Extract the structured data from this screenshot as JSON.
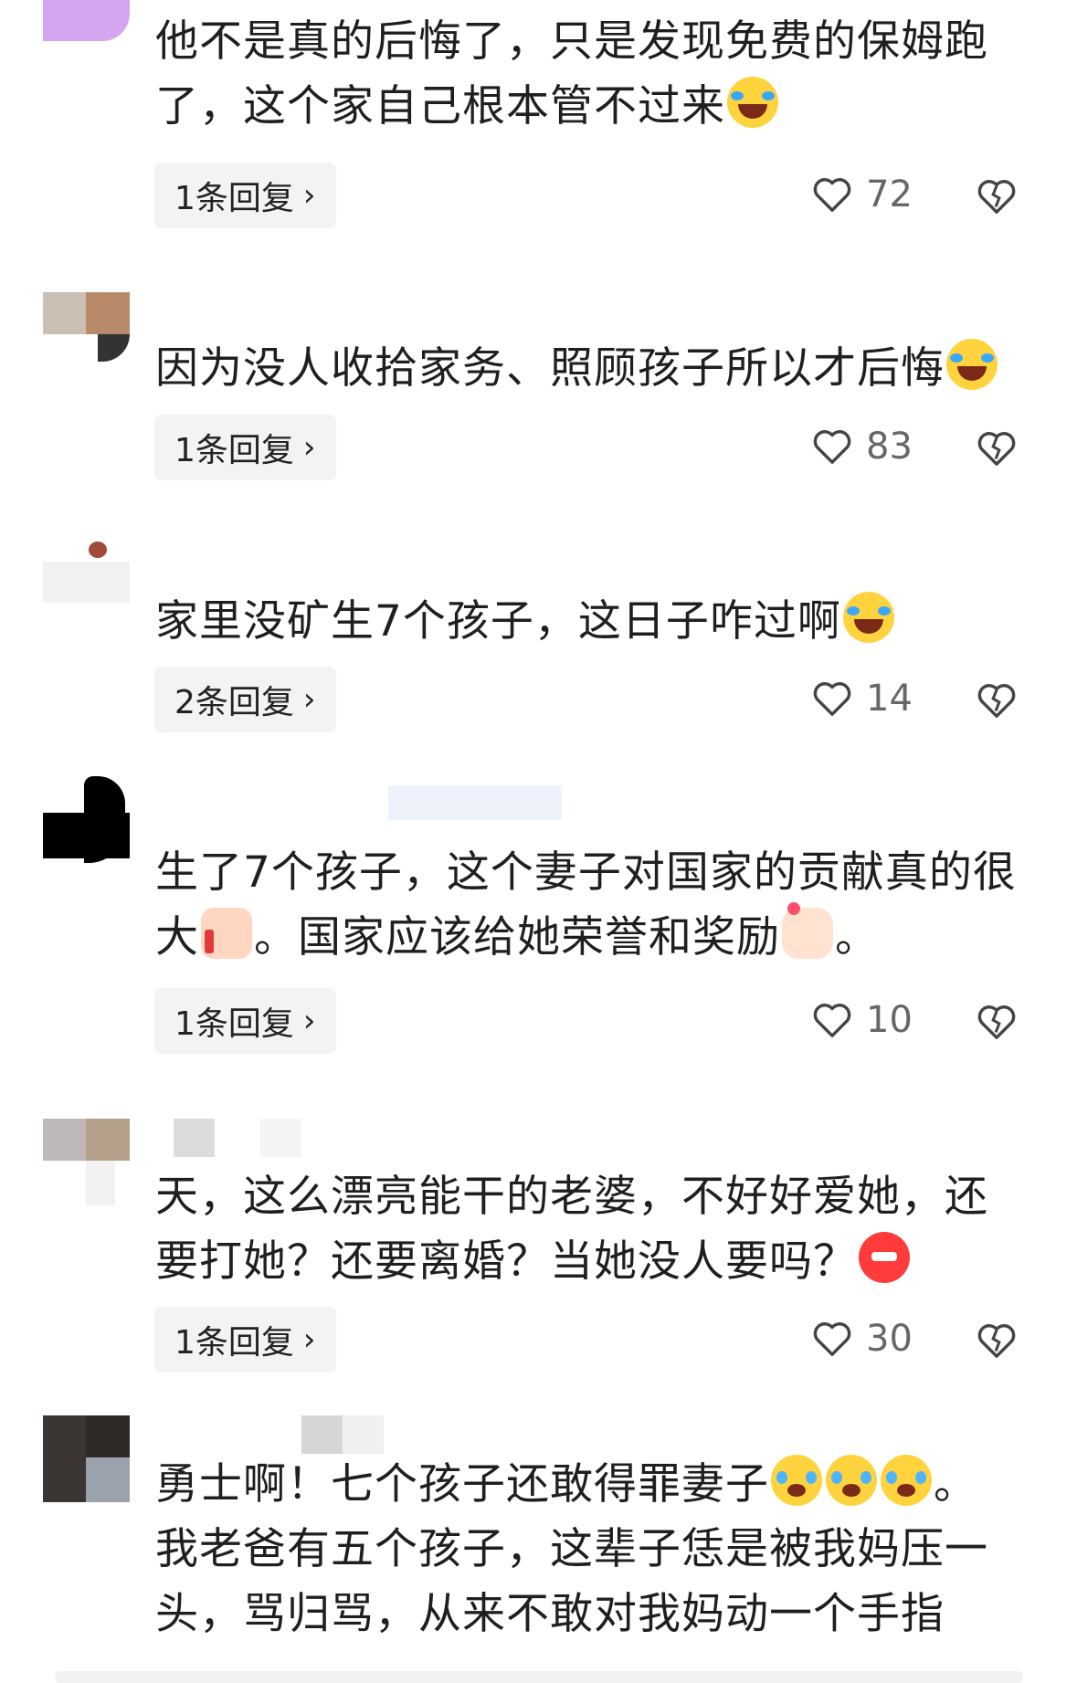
{
  "comments": [
    {
      "text_parts": [
        "他不是真的后悔了，只是发现免费的保姆跑",
        "了，这个家自己根本管不过来"
      ],
      "emoji": [
        "laugh-cry-icon"
      ],
      "reply_label": "1条回复",
      "likes": "72"
    },
    {
      "text_parts": [
        "因为没人收拾家务、照顾孩子所以才后悔"
      ],
      "emoji": [
        "laughing-icon"
      ],
      "reply_label": "1条回复",
      "likes": "83"
    },
    {
      "text_parts": [
        "家里没矿生7个孩子，这日子咋过啊"
      ],
      "emoji": [
        "laugh-cry-icon"
      ],
      "reply_label": "2条回复",
      "likes": "14"
    },
    {
      "text_parts": [
        "生了7个孩子，这个妻子对国家的贡献真的很",
        "大",
        "。国家应该给她荣誉和奖励",
        "。"
      ],
      "emoji": [
        "thumbs-up-icon",
        "finger-heart-icon"
      ],
      "reply_label": "1条回复",
      "likes": "10"
    },
    {
      "text_parts": [
        "天，这么漂亮能干的老婆，不好好爱她，还",
        "要打她？还要离婚？当她没人要吗？"
      ],
      "emoji": [
        "angry-face-icon"
      ],
      "reply_label": "1条回复",
      "likes": "30"
    },
    {
      "text_parts": [
        "勇士啊！七个孩子还敢得罪妻子",
        "。",
        "我老爸有五个孩子，这辈子恁是被我妈压一",
        "头，骂归骂，从来不敢对我妈动一个手指"
      ],
      "emoji": [
        "crying-face-icon",
        "crying-face-icon",
        "crying-face-icon"
      ]
    }
  ],
  "colors": {
    "background": "#ffffff",
    "text": "#1f1f1f",
    "reply_bg": "#f3f3f3",
    "icon_gray": "#666666"
  }
}
